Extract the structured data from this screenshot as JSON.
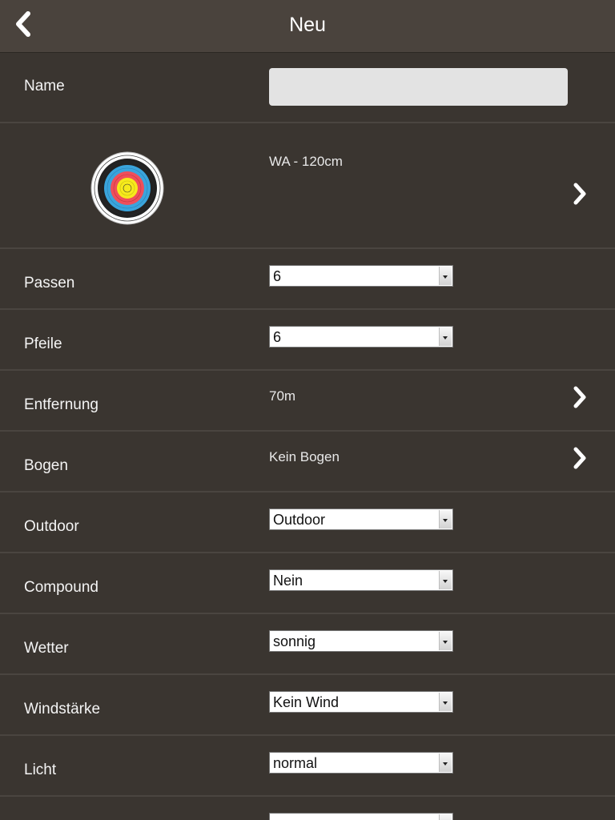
{
  "header": {
    "title": "Neu"
  },
  "form": {
    "name": {
      "label": "Name",
      "value": ""
    },
    "target": {
      "value": "WA - 120cm",
      "icon": "archery-target-icon"
    },
    "passen": {
      "label": "Passen",
      "value": "6"
    },
    "pfeile": {
      "label": "Pfeile",
      "value": "6"
    },
    "entfernung": {
      "label": "Entfernung",
      "value": "70m"
    },
    "bogen": {
      "label": "Bogen",
      "value": "Kein Bogen"
    },
    "outdoor": {
      "label": "Outdoor",
      "value": "Outdoor"
    },
    "compound": {
      "label": "Compound",
      "value": "Nein"
    },
    "wetter": {
      "label": "Wetter",
      "value": "sonnig"
    },
    "windstaerke": {
      "label": "Windstärke",
      "value": "Kein Wind"
    },
    "licht": {
      "label": "Licht",
      "value": "normal"
    }
  },
  "colors": {
    "background": "#3a3530",
    "navbar": "#4a433d",
    "divider": "#4a4540"
  }
}
